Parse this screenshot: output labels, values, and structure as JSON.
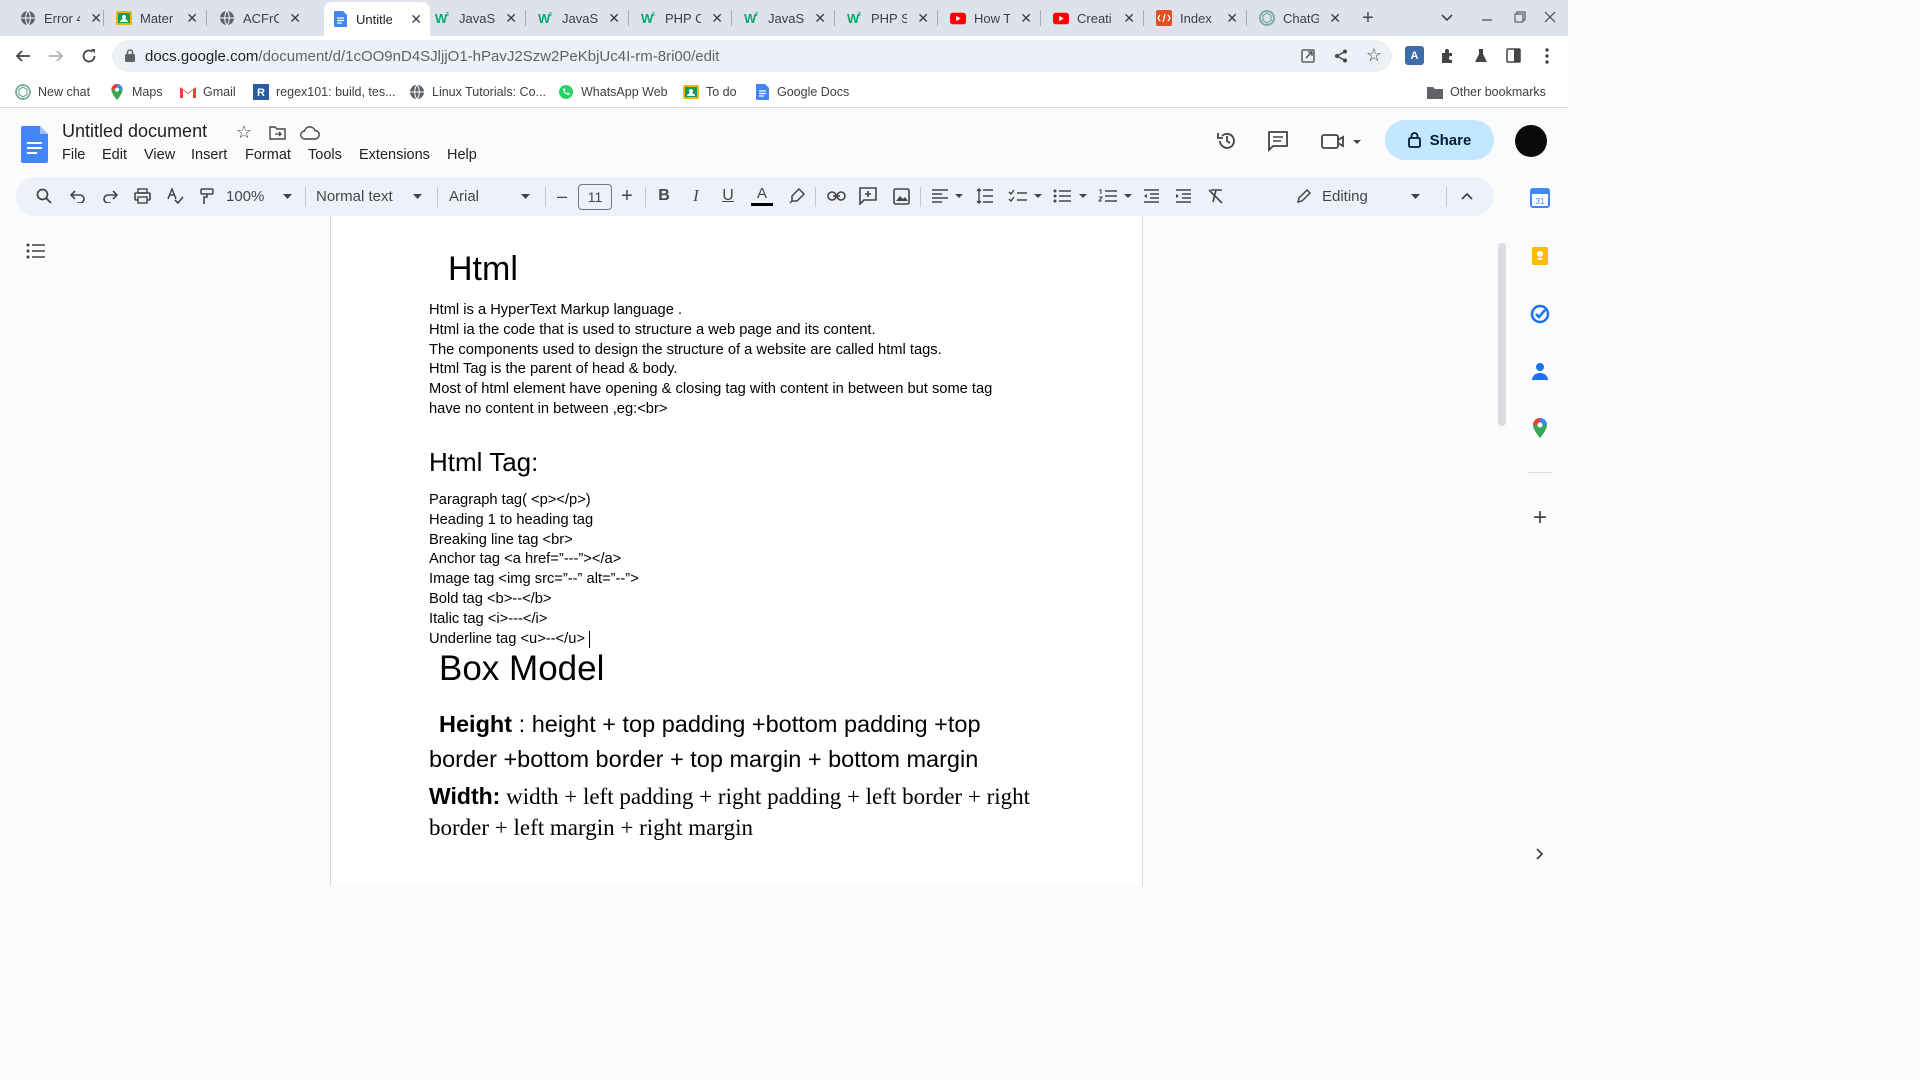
{
  "browser": {
    "tabs": [
      {
        "title": "Error 4",
        "icon": "globe-icon",
        "color": "#5f6368"
      },
      {
        "title": "Mater",
        "icon": "classroom-icon",
        "color": "#f4b400"
      },
      {
        "title": "ACFrO",
        "icon": "globe-icon",
        "color": "#5f6368"
      },
      {
        "title": "Untitle",
        "icon": "docs-icon",
        "color": "#4285f4",
        "active": true
      },
      {
        "title": "JavaS",
        "icon": "w3schools-icon",
        "color": "#04aa6d"
      },
      {
        "title": "JavaS",
        "icon": "w3schools-icon",
        "color": "#04aa6d"
      },
      {
        "title": "PHP C",
        "icon": "w3schools-icon",
        "color": "#04aa6d"
      },
      {
        "title": "JavaS",
        "icon": "w3schools-icon",
        "color": "#04aa6d"
      },
      {
        "title": "PHP S",
        "icon": "w3schools-icon",
        "color": "#04aa6d"
      },
      {
        "title": "How T",
        "icon": "youtube-icon",
        "color": "#ff0000"
      },
      {
        "title": "Creati",
        "icon": "youtube-icon",
        "color": "#ff0000"
      },
      {
        "title": "Index",
        "icon": "html-icon",
        "color": "#e44d26"
      },
      {
        "title": "ChatG",
        "icon": "openai-icon",
        "color": "#74aa9c"
      }
    ],
    "url_domain": "docs.google.com",
    "url_path": "/document/d/1cOO9nD4SJljjO1-hPavJ2Szw2PeKbjUc4I-rm-8ri00/edit",
    "bookmarks": [
      {
        "label": "New chat",
        "icon": "openai-icon",
        "color": "#74aa9c"
      },
      {
        "label": "Maps",
        "icon": "maps-icon",
        "color": "#34a853"
      },
      {
        "label": "Gmail",
        "icon": "gmail-icon",
        "color": "#ea4335"
      },
      {
        "label": "regex101: build, tes...",
        "icon": "regex101-icon",
        "color": "#2c5aa0"
      },
      {
        "label": "Linux Tutorials: Co...",
        "icon": "globe-icon",
        "color": "#5f6368"
      },
      {
        "label": "WhatsApp Web",
        "icon": "whatsapp-icon",
        "color": "#25d366"
      },
      {
        "label": "To do",
        "icon": "classroom-icon",
        "color": "#f4b400"
      },
      {
        "label": "Google Docs",
        "icon": "docs-icon",
        "color": "#4285f4"
      }
    ],
    "other_bookmarks": "Other bookmarks"
  },
  "docs": {
    "title": "Untitled document",
    "menu": [
      "File",
      "Edit",
      "View",
      "Insert",
      "Format",
      "Tools",
      "Extensions",
      "Help"
    ],
    "share_label": "Share",
    "toolbar": {
      "zoom": "100%",
      "style": "Normal text",
      "font": "Arial",
      "font_size": "11",
      "mode": "Editing"
    }
  },
  "document": {
    "h1_html": "Html",
    "html_lines": [
      "Html is a HyperText Markup  language .",
      "Html ia the code that is used to  structure a web page and its content.",
      "The components used to design  the structure of a website  are called html tags.",
      "Html Tag is the parent of head & body.",
      "Most  of html element have opening & closing  tag with content  in between but some tag",
      "have no content in between ,eg:<br>"
    ],
    "h2_tag": "Html Tag:",
    "tag_lines": [
      "Paragraph  tag( <p></p>)",
      "Heading 1 to heading tag",
      "Breaking line  tag <br>",
      "Anchor tag <a href=”---”></a>",
      "Image tag <img src=”--” alt=”--”>",
      "Bold  tag <b>--</b>",
      "Italic tag  <i>---</i>",
      "Underline tag <u>--</u>"
    ],
    "h1_box": "Box Model",
    "height_label": "Height",
    "height_text": " : height + top padding +bottom padding +top",
    "height_line2": "border +bottom border + top margin + bottom margin",
    "width_label": "Width:",
    "width_text": " width + left padding + right padding + left border + right",
    "width_line2": "border + left margin + right margin"
  }
}
